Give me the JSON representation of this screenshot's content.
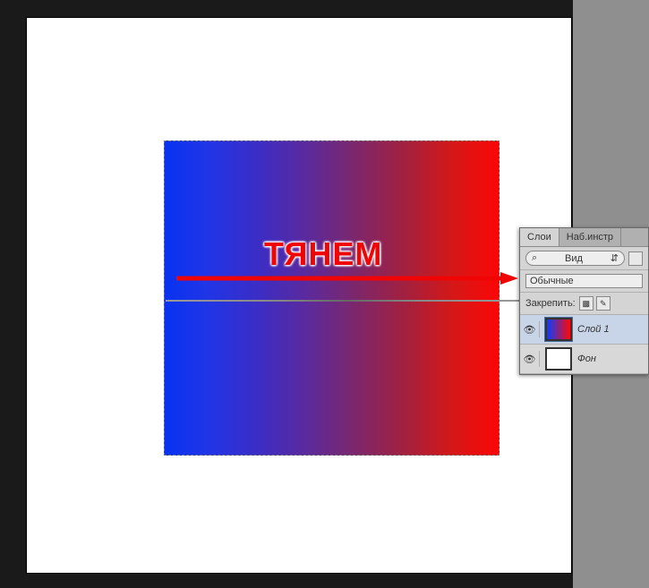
{
  "annotation": {
    "text": "ТЯНЕМ"
  },
  "layersPanel": {
    "tabs": {
      "layers": "Слои",
      "navInstr": "Наб.инстр"
    },
    "filter": {
      "label": "Вид"
    },
    "blendMode": "Обычные",
    "lockLabel": "Закрепить:",
    "layers": [
      {
        "name": "Слой 1",
        "selected": true,
        "thumbType": "gradient"
      },
      {
        "name": "Фон",
        "selected": false,
        "thumbType": "white"
      }
    ]
  }
}
